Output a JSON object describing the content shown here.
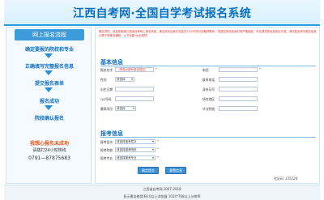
{
  "header": {
    "title": "江西自考网·全国自学考试报名系统"
  },
  "sidebar": {
    "title": "网上报名流程",
    "steps": [
      "确定要报的院校和专业",
      "正确填写完整报名信息",
      "提交报名表单",
      "报名成功",
      "院校确认报名"
    ],
    "hotline_title": "我想心报名未成功",
    "hotline_text": "请拨打24小时热线",
    "hotline_phone": "0791—87875683"
  },
  "notice": {
    "text": "报名须知：欢迎您使用江西省自考网上报名系统，报名成功后我们将会在24小时内与您取得联系。您提交的信息我们将严格保密，本站提供的信息真实可靠，请您如实填写报名信息以便于审核及通知，以下标星*为必填项"
  },
  "basic": {
    "title": "基本信息",
    "fields": {
      "name_label": "报名名字",
      "name_hint": "（请务必填写真实姓名）",
      "phone_label": "电话",
      "gender_label": "性别",
      "gender_value": "请选择",
      "contact_label": "联系电话",
      "birth_label": "出生日期",
      "id_label": "身份证号",
      "qq_label": "QQ号码",
      "region_label": "所在地区",
      "edu_label": "最高学历",
      "edu_value": "请选择",
      "school_label": "毕业院校"
    }
  },
  "apply": {
    "title": "报考信息",
    "level_label": "报考层次",
    "level_value": "请选择报考层次",
    "college_label": "报考院校",
    "college_value": "请选择报考院校",
    "major_label": "报考专业",
    "major_value": "请选择报考专业"
  },
  "buttons": {
    "submit": "确定提交",
    "reset": "重置信息"
  },
  "code": {
    "label": "验证码",
    "value": "335224"
  },
  "footer": {
    "line1": "江西省自考网  2007-2018",
    "line2": "显示建议使用IE8.0以上浏览器 1024*768以上分辨率"
  }
}
